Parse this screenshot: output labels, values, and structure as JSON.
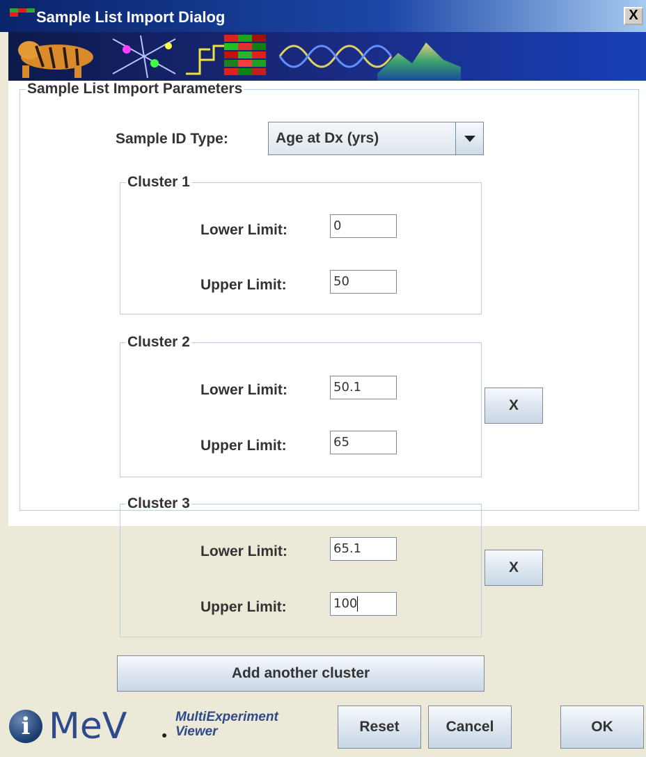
{
  "window": {
    "title": "Sample List Import Dialog",
    "close_label": "X"
  },
  "params": {
    "legend": "Sample List Import Parameters",
    "sample_id_label": "Sample ID Type:",
    "sample_id_value": "Age at Dx (yrs)"
  },
  "clusters": [
    {
      "legend": "Cluster 1",
      "lower_label": "Lower Limit:",
      "lower_value": "0",
      "upper_label": "Upper Limit:",
      "upper_value": "50"
    },
    {
      "legend": "Cluster 2",
      "lower_label": "Lower Limit:",
      "lower_value": "50.1",
      "upper_label": "Upper Limit:",
      "upper_value": "65",
      "remove_label": "X"
    },
    {
      "legend": "Cluster 3",
      "lower_label": "Lower Limit:",
      "lower_value": "65.1",
      "upper_label": "Upper Limit:",
      "upper_value": "100",
      "remove_label": "X"
    }
  ],
  "add_cluster_label": "Add another cluster",
  "footer": {
    "logo_text": "MeV",
    "logo_sub_line1": "MultiExperiment",
    "logo_sub_line2": "Viewer",
    "info_icon": "i",
    "reset_label": "Reset",
    "cancel_label": "Cancel",
    "ok_label": "OK"
  }
}
